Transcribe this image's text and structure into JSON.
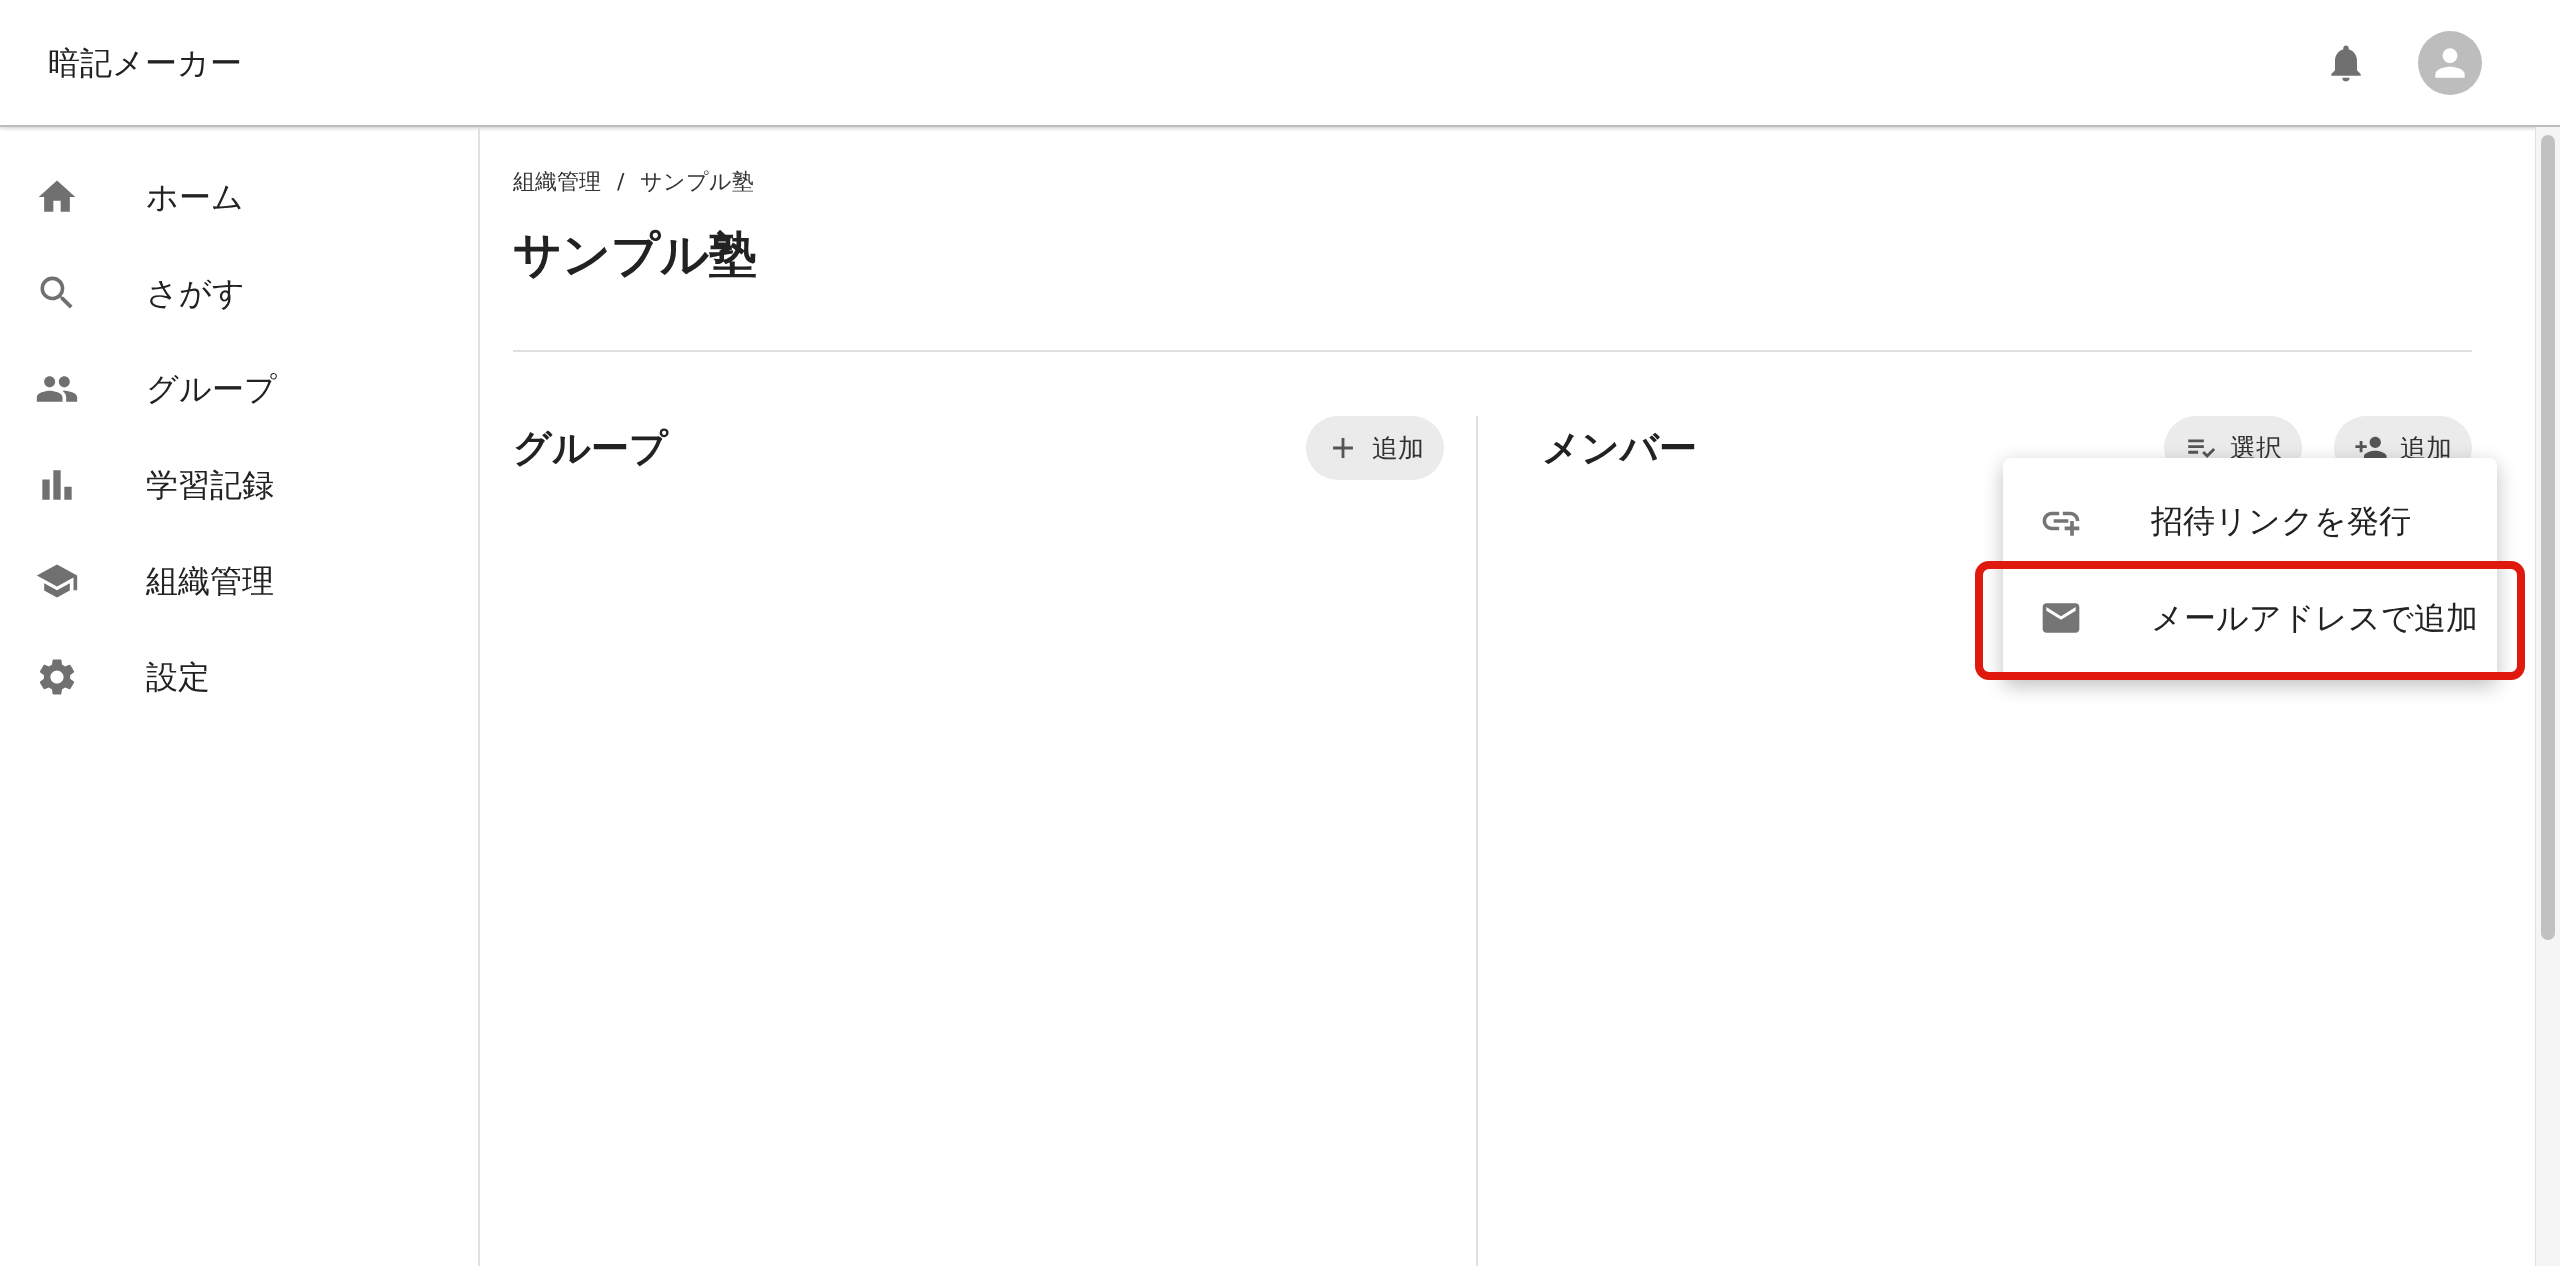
{
  "app_bar": {
    "title": "暗記メーカー"
  },
  "sidebar": {
    "items": [
      {
        "label": "ホーム",
        "kind": "home"
      },
      {
        "label": "さがす",
        "kind": "search"
      },
      {
        "label": "グループ",
        "kind": "people"
      },
      {
        "label": "学習記録",
        "kind": "chart"
      },
      {
        "label": "組織管理",
        "kind": "school"
      },
      {
        "label": "設定",
        "kind": "settings"
      }
    ]
  },
  "breadcrumb": [
    "組織管理",
    "/",
    "サンプル塾"
  ],
  "page_title": "サンプル塾",
  "groups_section": {
    "title": "グループ",
    "buttons": [
      {
        "label": "追加",
        "kind": "add"
      }
    ]
  },
  "members_section": {
    "title": "メンバー",
    "buttons": [
      {
        "label": "選択",
        "kind": "checklist"
      },
      {
        "label": "追加",
        "kind": "person_add"
      }
    ]
  },
  "menu": {
    "items": [
      {
        "label": "招待リンクを発行",
        "kind": "link",
        "highlighted": false
      },
      {
        "label": "メールアドレスで追加",
        "kind": "email",
        "highlighted": true
      }
    ]
  }
}
